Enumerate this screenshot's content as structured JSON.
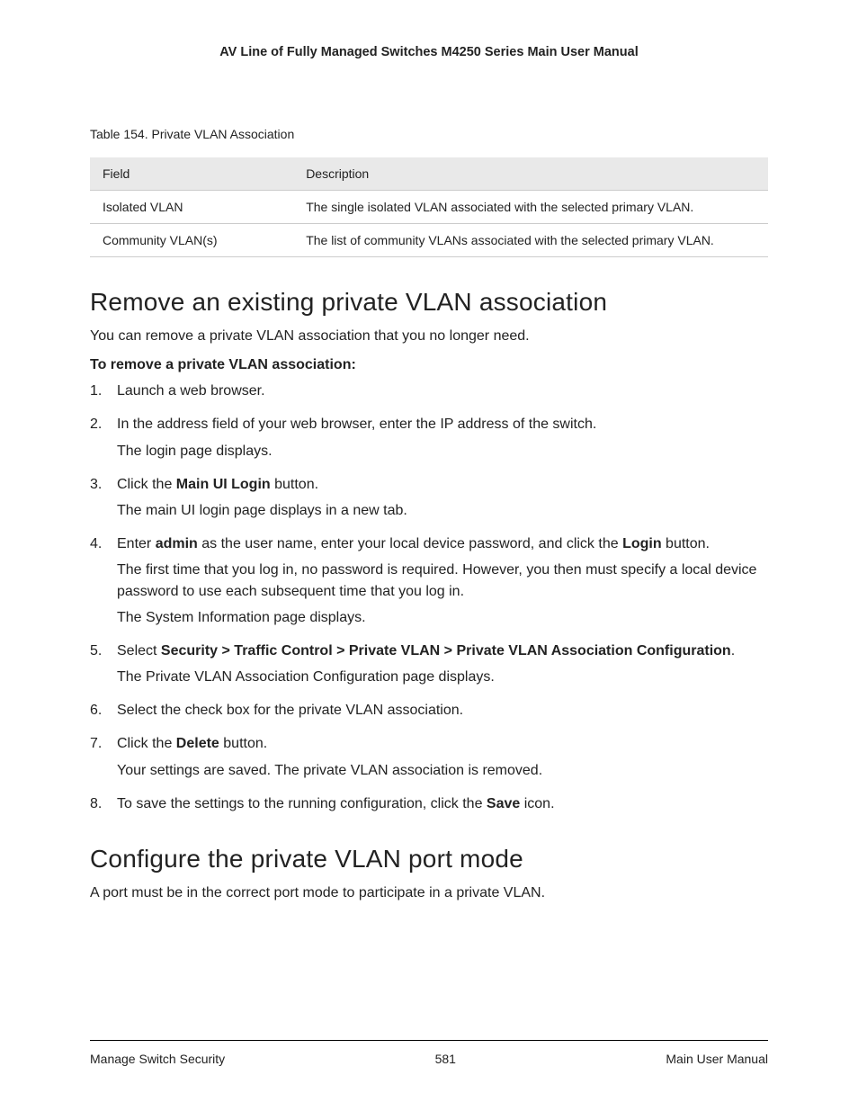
{
  "header": {
    "running": "AV Line of Fully Managed Switches M4250 Series Main User Manual"
  },
  "table": {
    "caption": "Table 154. Private VLAN Association",
    "headers": {
      "field": "Field",
      "description": "Description"
    },
    "rows": [
      {
        "field": "Isolated VLAN",
        "description": "The single isolated VLAN associated with the selected primary VLAN."
      },
      {
        "field": "Community VLAN(s)",
        "description": "The list of community VLANs associated with the selected primary VLAN."
      }
    ]
  },
  "section1": {
    "heading": "Remove an existing private VLAN association",
    "intro": "You can remove a private VLAN association that you no longer need.",
    "lead": "To remove a private VLAN association:",
    "step1": "Launch a web browser.",
    "step2_a": "In the address field of your web browser, enter the IP address of the switch.",
    "step2_b": "The login page displays.",
    "step3_a1": "Click the ",
    "step3_a_bold": "Main UI Login",
    "step3_a2": " button.",
    "step3_b": "The main UI login page displays in a new tab.",
    "step4_a1": "Enter ",
    "step4_a_bold1": "admin",
    "step4_a2": " as the user name, enter your local device password, and click the ",
    "step4_a_bold2": "Login",
    "step4_a3": " button.",
    "step4_b": "The first time that you log in, no password is required. However, you then must specify a local device password to use each subsequent time that you log in.",
    "step4_c": "The System Information page displays.",
    "step5_a1": "Select ",
    "step5_a_bold": "Security > Traffic Control > Private VLAN > Private VLAN Association Configuration",
    "step5_a2": ".",
    "step5_b": "The Private VLAN Association Configuration page displays.",
    "step6": "Select the check box for the private VLAN association.",
    "step7_a1": "Click the ",
    "step7_a_bold": "Delete",
    "step7_a2": " button.",
    "step7_b": "Your settings are saved. The private VLAN association is removed.",
    "step8_a1": "To save the settings to the running configuration, click the ",
    "step8_a_bold": "Save",
    "step8_a2": " icon."
  },
  "section2": {
    "heading": "Configure the private VLAN port mode",
    "intro": "A port must be in the correct port mode to participate in a private VLAN."
  },
  "footer": {
    "left": "Manage Switch Security",
    "center": "581",
    "right": "Main User Manual"
  }
}
